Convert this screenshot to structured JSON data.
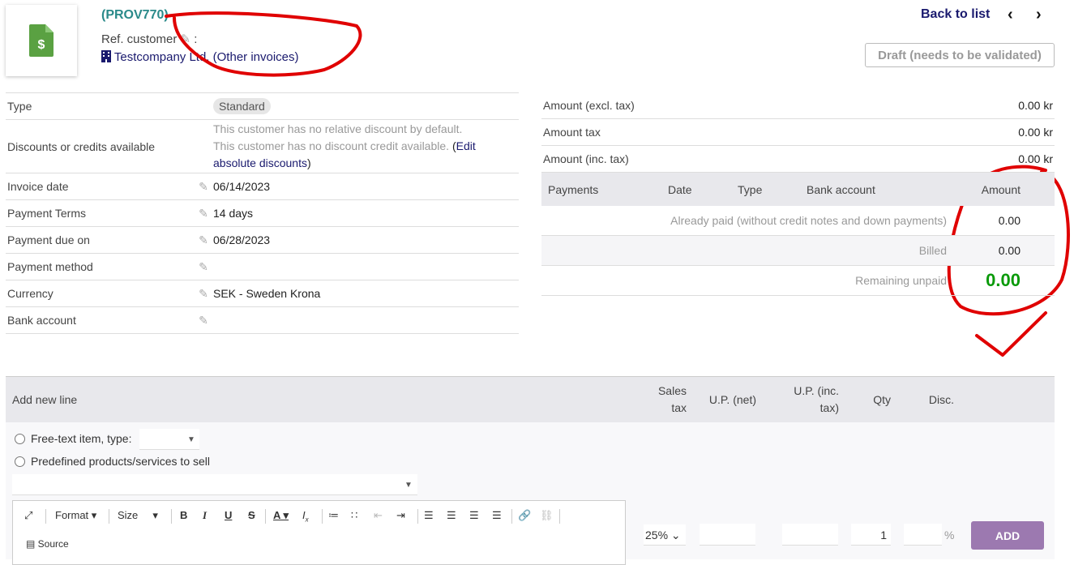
{
  "header": {
    "ref": "(PROV770)",
    "ref_customer_label": "Ref. customer",
    "ref_customer_sep": ":",
    "company": "Testcompany Ltd.",
    "other_invoices": "(Other invoices)",
    "back_to_list": "Back to list",
    "prev": "<",
    "next": ">",
    "status": "Draft (needs to be validated)"
  },
  "info": {
    "type_label": "Type",
    "type_value": "Standard",
    "discounts_label": "Discounts or credits available",
    "discount_line1": "This customer has no relative discount by default.",
    "discount_line2": "This customer has no discount credit available.",
    "discount_link_open": "(",
    "discount_link": "Edit absolute discounts",
    "discount_link_close": ")",
    "invoice_date_label": "Invoice date",
    "invoice_date": "06/14/2023",
    "payment_terms_label": "Payment Terms",
    "payment_terms": "14 days",
    "payment_due_label": "Payment due on",
    "payment_due": "06/28/2023",
    "payment_method_label": "Payment method",
    "currency_label": "Currency",
    "currency": "SEK - Sweden Krona",
    "bank_account_label": "Bank account"
  },
  "amounts": {
    "excl_label": "Amount (excl. tax)",
    "excl": "0.00 kr",
    "tax_label": "Amount tax",
    "tax": "0.00 kr",
    "inc_label": "Amount (inc. tax)",
    "inc": "0.00 kr"
  },
  "payments": {
    "headers": [
      "Payments",
      "Date",
      "Type",
      "Bank account",
      "Amount"
    ],
    "already_paid_label": "Already paid (without credit notes and down payments)",
    "already_paid": "0.00",
    "billed_label": "Billed",
    "billed": "0.00",
    "remaining_label": "Remaining unpaid",
    "remaining": "0.00"
  },
  "addline": {
    "title": "Add new line",
    "col_sales_tax_1": "Sales",
    "col_sales_tax_2": "tax",
    "col_up_net": "U.P. (net)",
    "col_up_inc_1": "U.P. (inc.",
    "col_up_inc_2": "tax)",
    "col_qty": "Qty",
    "col_disc": "Disc.",
    "free_text": "Free-text item, type:",
    "predefined": "Predefined products/services to sell",
    "toolbar_format": "Format",
    "toolbar_size": "Size",
    "toolbar_source": "Source",
    "vat": "25%",
    "qty": "1",
    "pct": "%",
    "add_button": "ADD"
  },
  "colors": {
    "accent": "#9c79b0",
    "ref": "#2a8a8a",
    "link": "#1a1a6e",
    "remaining": "#0a9a0a",
    "annotation": "#e00000"
  }
}
